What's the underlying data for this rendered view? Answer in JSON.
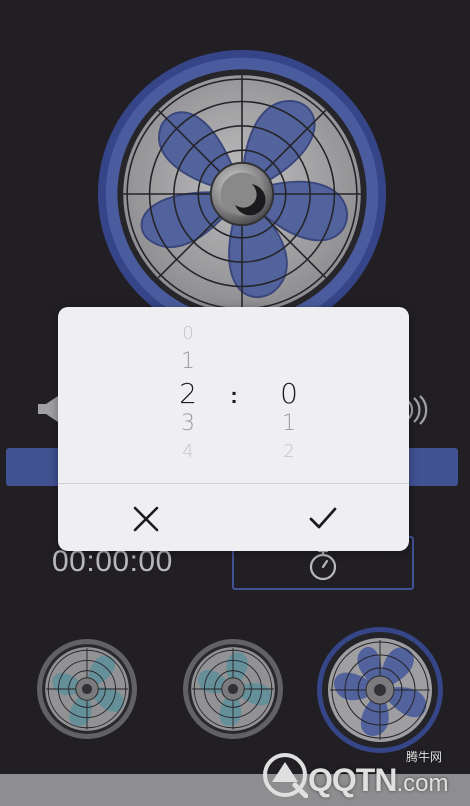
{
  "colors": {
    "background": "#262429",
    "accent_blue": "#4a5ea8",
    "dialog_background": "#efeef1",
    "fan_blade_blue": "#5a6db2",
    "fan_blade_teal": "#6fa4b0"
  },
  "timer": {
    "display": "00:00:00",
    "button_icon": "stopwatch-icon"
  },
  "main_fan": {
    "icon": "moon-icon",
    "style": "blue-blades"
  },
  "presets": [
    {
      "id": "preset-1",
      "style": "teal-blades",
      "selected": false
    },
    {
      "id": "preset-2",
      "style": "teal-blades",
      "selected": false
    },
    {
      "id": "preset-3",
      "style": "blue-blades",
      "selected": true
    }
  ],
  "picker": {
    "hours": {
      "above2": "0",
      "above1": "1",
      "selected": "2",
      "below1": "3",
      "below2": "4"
    },
    "separator": ":",
    "minutes": {
      "selected": "0",
      "below1": "1",
      "below2": "2"
    },
    "cancel_icon": "close-icon",
    "confirm_icon": "checkmark-icon"
  },
  "watermark": {
    "logo_text": "QQTN",
    "suffix": ".com",
    "caption": "腾牛网"
  }
}
